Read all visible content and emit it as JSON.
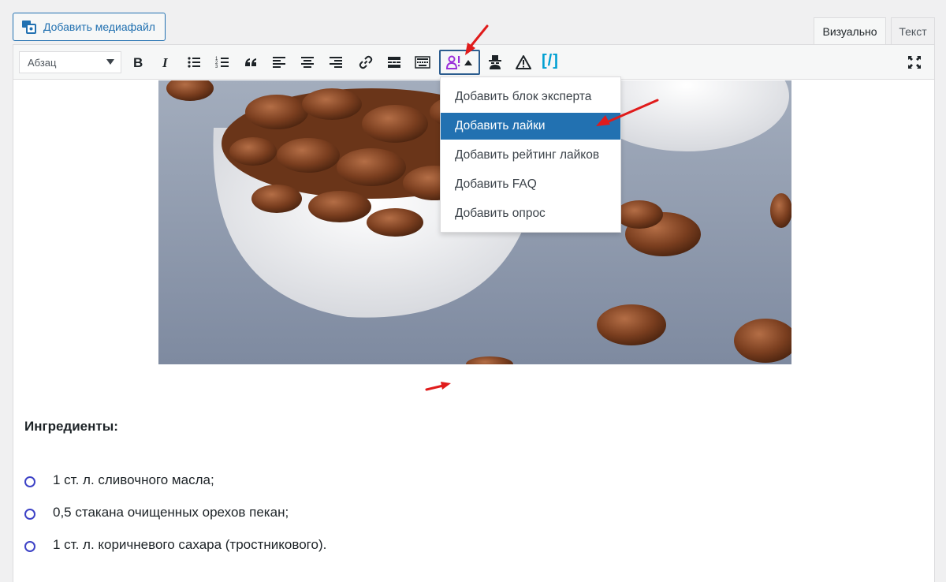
{
  "top_bar": {
    "media_button": "Добавить медиафайл",
    "tab_visual": "Визуально",
    "tab_text": "Текст"
  },
  "toolbar": {
    "format_select_value": "Абзац",
    "buttons": [
      "bold-icon",
      "italic-icon",
      "bullet-list-icon",
      "numbered-list-icon",
      "blockquote-icon",
      "align-left-icon",
      "align-center-icon",
      "align-right-icon",
      "link-icon",
      "read-more-icon",
      "toolbar-toggle-icon",
      "expert-plugin-icon",
      "spy-icon",
      "warning-icon",
      "shortcode-icon",
      "fullscreen-icon"
    ],
    "shortcode_glyph": "[/]"
  },
  "dropdown": {
    "items": [
      "Добавить блок эксперта",
      "Добавить лайки",
      "Добавить рейтинг лайков",
      "Добавить FAQ",
      "Добавить опрос"
    ],
    "active_index": 1
  },
  "content": {
    "heading": "Ингредиенты:",
    "list": [
      "1 ст. л. сливочного масла;",
      "0,5 стакана очищенных орехов пекан;",
      "1 ст. л. коричневого сахара (тростникового)."
    ]
  },
  "colors": {
    "accent": "#2271b1",
    "bullet": "#3d42c6",
    "arrow": "#e01b1b",
    "plugin_icon": "#9b30d9",
    "shortcode": "#00a0d2"
  }
}
